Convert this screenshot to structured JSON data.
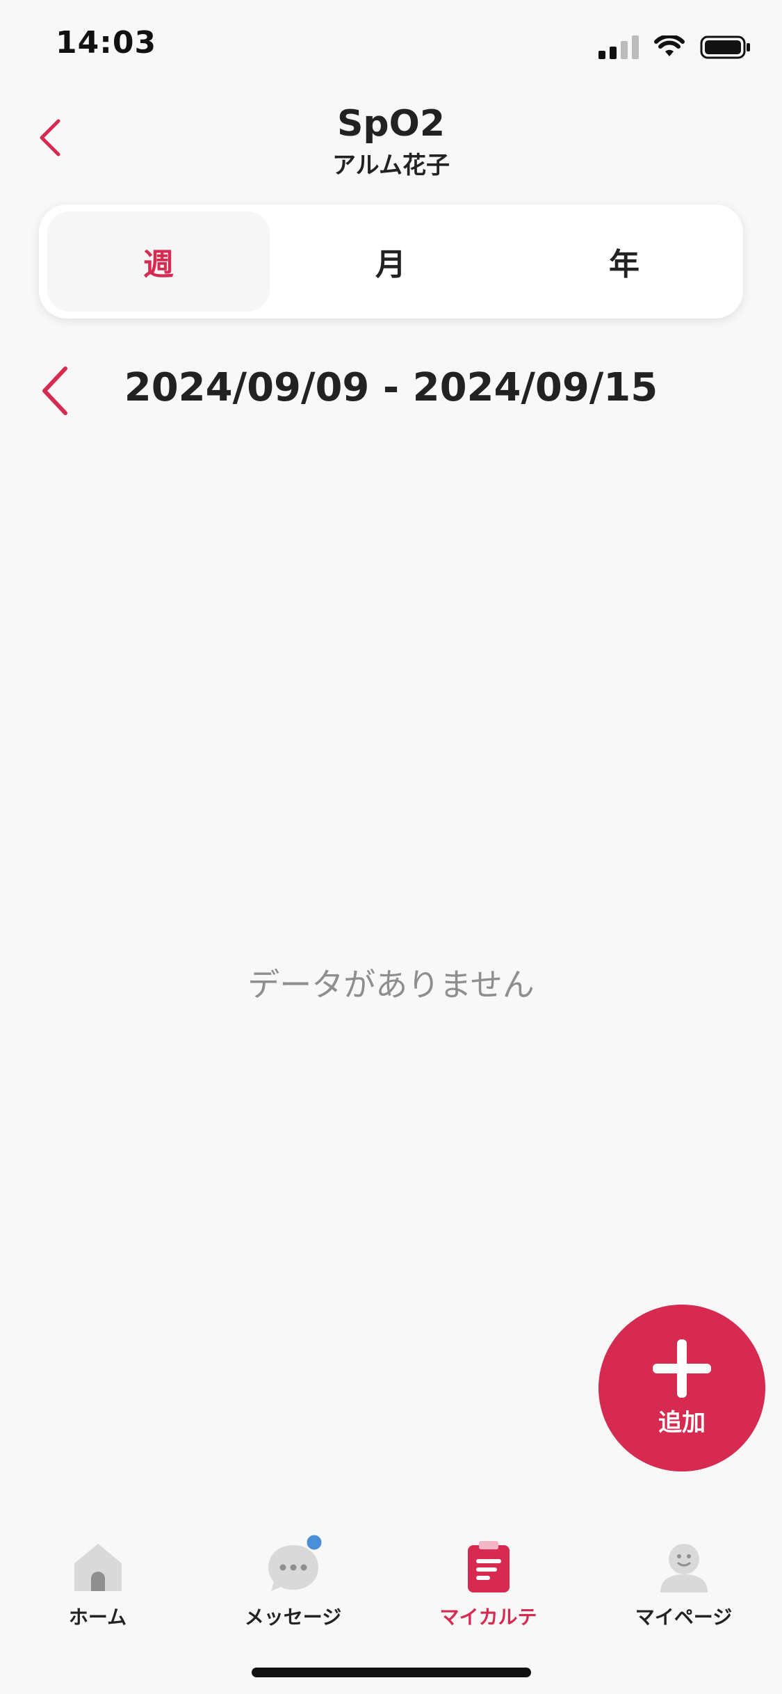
{
  "status_bar": {
    "time": "14:03"
  },
  "header": {
    "title": "SpO2",
    "subtitle": "アルム花子"
  },
  "period_tabs": [
    {
      "label": "週",
      "active": true
    },
    {
      "label": "月",
      "active": false
    },
    {
      "label": "年",
      "active": false
    }
  ],
  "date_range": "2024/09/09 - 2024/09/15",
  "empty_message": "データがありません",
  "fab": {
    "label": "追加"
  },
  "tabbar": {
    "items": [
      {
        "label": "ホーム",
        "icon": "home-icon",
        "active": false
      },
      {
        "label": "メッセージ",
        "icon": "message-icon",
        "active": false,
        "badge": true
      },
      {
        "label": "マイカルテ",
        "icon": "chart-record-icon",
        "active": true
      },
      {
        "label": "マイページ",
        "icon": "person-icon",
        "active": false
      }
    ]
  },
  "colors": {
    "accent": "#d62a50",
    "badge": "#4a90d9",
    "inactive_icon": "#d9d9d9",
    "background": "#f8f8f8"
  }
}
